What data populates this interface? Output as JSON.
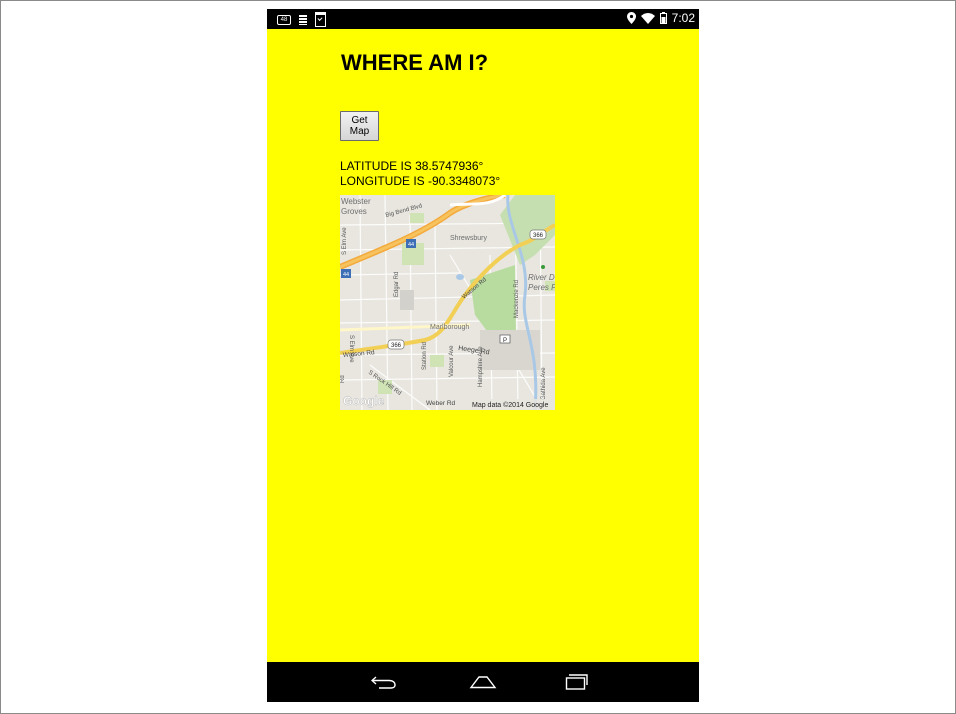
{
  "status_bar": {
    "badge_text": "48",
    "time": "7:02",
    "icons": [
      "notification-badge-icon",
      "bars-icon",
      "clipboard-check-icon",
      "location-pin-icon",
      "wifi-icon",
      "battery-icon"
    ]
  },
  "page": {
    "title": "WHERE AM I?",
    "get_map_label": "Get Map",
    "latitude_text": "LATITUDE IS 38.5747936°",
    "longitude_text": "LONGITUDE IS -90.3348073°",
    "background_color": "#ffff00"
  },
  "map": {
    "labels": {
      "webster": "Webster",
      "groves": "Groves",
      "big_bend": "Big Bend Blvd",
      "shrewsbury": "Shrewsbury",
      "route_366_top": "366",
      "route_44_a": "44",
      "route_44_b": "44",
      "s_elm_ave_top": "S Elm Ave",
      "edgar_rd": "Edgar Rd",
      "watson_rd_upper": "Watson Rd",
      "river_des": "River De",
      "peres_pa": "Peres Pa",
      "mackenzie_rd": "Mackenzie Rd",
      "s_elm_ave": "S Elm Ave",
      "marlborough": "Marlborough",
      "watson_rd": "Watson Rd",
      "route_366": "366",
      "parking": "P",
      "heege_rd": "Heege Rd",
      "station_rd": "Station Rd",
      "valcour_ave": "Valcour Ave",
      "hampshire_ave": "Hampshire Ave",
      "rd_left": "Rd",
      "rock_hill_rd": "S Rock Hill Rd",
      "weber_rd": "Weber Rd",
      "google_logo": "Google",
      "attribution": "Map data ©2014 Google",
      "gathida_ave": "Gathida Ave"
    }
  },
  "nav_bar": {
    "buttons": [
      "back-icon",
      "home-icon",
      "recents-icon"
    ]
  }
}
